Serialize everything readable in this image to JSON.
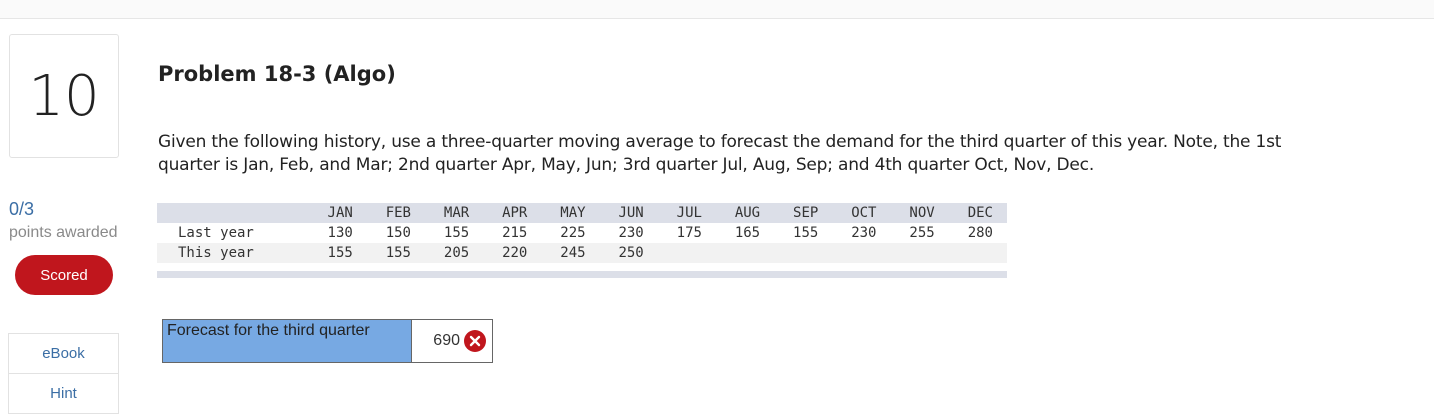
{
  "question": {
    "number": "10",
    "score": "0/3",
    "points_label": "points awarded",
    "status_button": "Scored"
  },
  "side_links": [
    "eBook",
    "Hint"
  ],
  "problem": {
    "title": "Problem 18-3 (Algo)",
    "prompt_line1": "Given the following history, use a three-quarter moving average to forecast the demand for the third quarter of this year. Note, the 1st",
    "prompt_line2": "quarter is Jan, Feb, and Mar; 2nd quarter Apr, May, Jun; 3rd quarter Jul, Aug, Sep; and 4th quarter Oct, Nov, Dec."
  },
  "history_table": {
    "months": [
      "JAN",
      "FEB",
      "MAR",
      "APR",
      "MAY",
      "JUN",
      "JUL",
      "AUG",
      "SEP",
      "OCT",
      "NOV",
      "DEC"
    ],
    "rows": [
      {
        "label": "Last year",
        "values": [
          "130",
          "150",
          "155",
          "215",
          "225",
          "230",
          "175",
          "165",
          "155",
          "230",
          "255",
          "280"
        ]
      },
      {
        "label": "This year",
        "values": [
          "155",
          "155",
          "205",
          "220",
          "245",
          "250",
          "",
          "",
          "",
          "",
          "",
          ""
        ]
      }
    ]
  },
  "answer": {
    "label": "Forecast for the third quarter",
    "value": "690",
    "status_icon": "incorrect-x-icon",
    "status_color": "#c0161d"
  }
}
